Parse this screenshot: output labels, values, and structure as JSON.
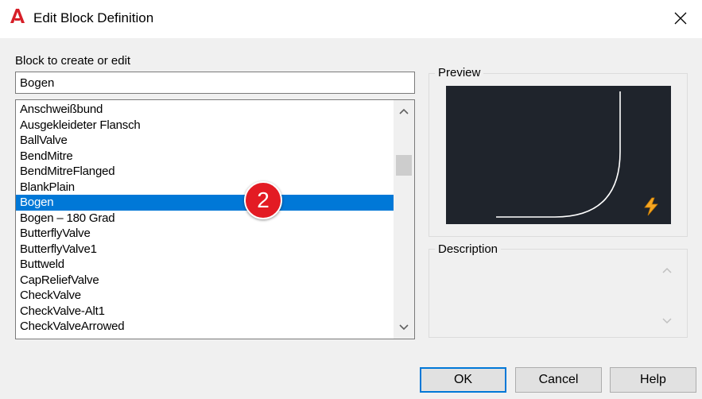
{
  "window": {
    "title": "Edit Block Definition",
    "close_glyph": "✕"
  },
  "block_field": {
    "label": "Block to create or edit",
    "value": "Bogen"
  },
  "block_list": {
    "items": [
      "Anschweißbund",
      "Ausgekleideter Flansch",
      "BallValve",
      "BendMitre",
      "BendMitreFlanged",
      "BlankPlain",
      "Bogen",
      "Bogen – 180 Grad",
      "ButterflyValve",
      "ButterflyValve1",
      "Buttweld",
      "CapReliefValve",
      "CheckValve",
      "CheckValve-Alt1",
      "CheckValveArrowed"
    ],
    "selected": "Bogen"
  },
  "callout_badge": "2",
  "preview": {
    "label": "Preview",
    "background": "#1f242c",
    "icon": "lightning-icon"
  },
  "description": {
    "label": "Description"
  },
  "buttons": {
    "ok": "OK",
    "cancel": "Cancel",
    "help": "Help"
  },
  "colors": {
    "selection": "#0078d7",
    "badge": "#e31b23",
    "app_icon": "#d71f28"
  }
}
